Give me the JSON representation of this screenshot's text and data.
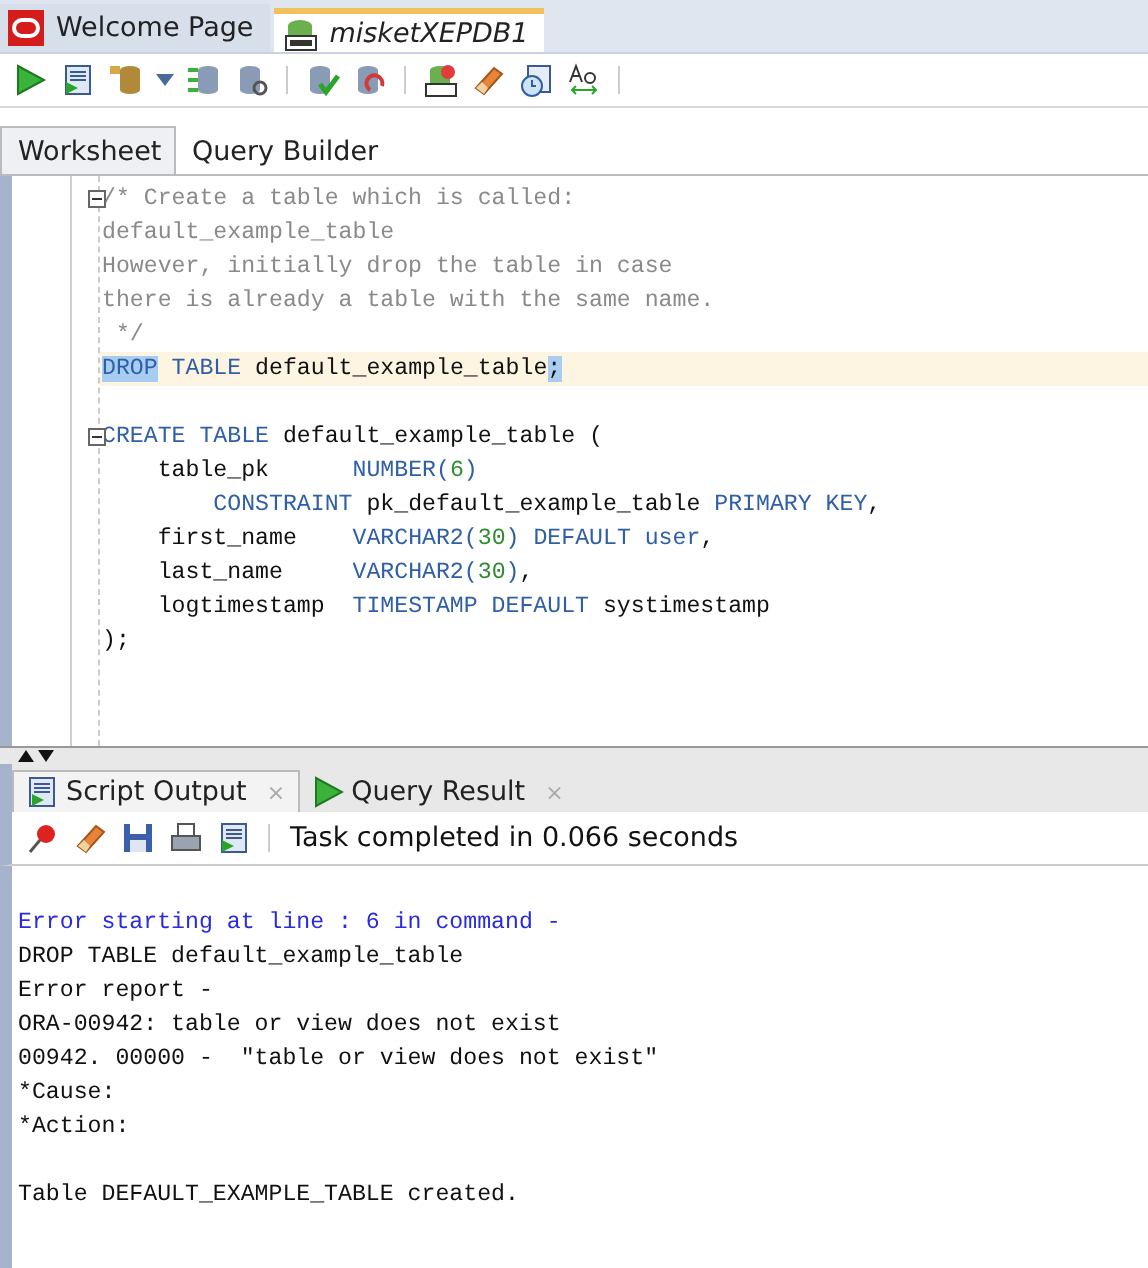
{
  "editor_tabs": [
    {
      "label": "Welcome Page",
      "selected": false
    },
    {
      "label": "misketXEPDB1",
      "selected": true
    }
  ],
  "sub_tabs": [
    {
      "label": "Worksheet",
      "selected": true
    },
    {
      "label": "Query Builder",
      "selected": false
    }
  ],
  "code_lines": [
    {
      "fold": true,
      "current": false,
      "tokens": [
        {
          "text": "/* Create a table which is called:",
          "kind": "comment",
          "highlighted": false
        }
      ]
    },
    {
      "fold": false,
      "current": false,
      "tokens": [
        {
          "text": "default_example_table",
          "kind": "comment",
          "highlighted": false
        }
      ]
    },
    {
      "fold": false,
      "current": false,
      "tokens": [
        {
          "text": "However, initially drop the table in case",
          "kind": "comment",
          "highlighted": false
        }
      ]
    },
    {
      "fold": false,
      "current": false,
      "tokens": [
        {
          "text": "there is already a table with the same name.",
          "kind": "comment",
          "highlighted": false
        }
      ]
    },
    {
      "fold": false,
      "current": false,
      "tokens": [
        {
          "text": " */",
          "kind": "comment",
          "highlighted": false
        }
      ]
    },
    {
      "fold": false,
      "current": true,
      "tokens": [
        {
          "text": "DROP",
          "kind": "keyword",
          "highlighted": true
        },
        {
          "text": " TABLE",
          "kind": "keyword",
          "highlighted": false
        },
        {
          "text": " default_example_table",
          "kind": "plain",
          "highlighted": false
        },
        {
          "text": ";",
          "kind": "plain",
          "highlighted": true
        }
      ]
    },
    {
      "fold": false,
      "current": false,
      "kind": "blank"
    },
    {
      "fold": true,
      "current": false,
      "tokens": [
        {
          "text": "CREATE TABLE",
          "kind": "keyword",
          "highlighted": false
        },
        {
          "text": " default_example_table (",
          "kind": "plain",
          "highlighted": false
        }
      ]
    },
    {
      "fold": false,
      "current": false,
      "tokens": [
        {
          "text": "    table_pk      ",
          "kind": "plain",
          "highlighted": false
        },
        {
          "text": "NUMBER(",
          "kind": "keyword",
          "highlighted": false
        },
        {
          "text": "6",
          "kind": "number",
          "highlighted": false
        },
        {
          "text": ")",
          "kind": "keyword",
          "highlighted": false
        }
      ]
    },
    {
      "fold": false,
      "current": false,
      "tokens": [
        {
          "text": "        CONSTRAINT",
          "kind": "keyword",
          "highlighted": false
        },
        {
          "text": " pk_default_example_table ",
          "kind": "plain",
          "highlighted": false
        },
        {
          "text": "PRIMARY KEY",
          "kind": "keyword",
          "highlighted": false
        },
        {
          "text": ",",
          "kind": "plain",
          "highlighted": false
        }
      ]
    },
    {
      "fold": false,
      "current": false,
      "tokens": [
        {
          "text": "    first_name    ",
          "kind": "plain",
          "highlighted": false
        },
        {
          "text": "VARCHAR2(",
          "kind": "keyword",
          "highlighted": false
        },
        {
          "text": "30",
          "kind": "number",
          "highlighted": false
        },
        {
          "text": ") DEFAULT user",
          "kind": "keyword",
          "highlighted": false
        },
        {
          "text": ",",
          "kind": "plain",
          "highlighted": false
        }
      ]
    },
    {
      "fold": false,
      "current": false,
      "tokens": [
        {
          "text": "    last_name     ",
          "kind": "plain",
          "highlighted": false
        },
        {
          "text": "VARCHAR2(",
          "kind": "keyword",
          "highlighted": false
        },
        {
          "text": "30",
          "kind": "number",
          "highlighted": false
        },
        {
          "text": ")",
          "kind": "keyword",
          "highlighted": false
        },
        {
          "text": ",",
          "kind": "plain",
          "highlighted": false
        }
      ]
    },
    {
      "fold": false,
      "current": false,
      "tokens": [
        {
          "text": "    logtimestamp  ",
          "kind": "plain",
          "highlighted": false
        },
        {
          "text": "TIMESTAMP DEFAULT",
          "kind": "keyword",
          "highlighted": false
        },
        {
          "text": " systimestamp",
          "kind": "plain",
          "highlighted": false
        }
      ]
    },
    {
      "fold": false,
      "current": false,
      "tokens": [
        {
          "text": ");",
          "kind": "plain",
          "highlighted": false
        }
      ]
    }
  ],
  "output_tabs": [
    {
      "label": "Script Output",
      "close": "×",
      "selected": true
    },
    {
      "label": "Query Result",
      "close": "×",
      "selected": false
    }
  ],
  "status": "Task completed in 0.066 seconds",
  "output_lines": [
    {
      "kind": "blank"
    },
    {
      "kind": "error",
      "text": "Error starting at line : 6 in command -"
    },
    {
      "kind": "plain",
      "text": "DROP TABLE default_example_table"
    },
    {
      "kind": "plain",
      "text": "Error report -"
    },
    {
      "kind": "plain",
      "text": "ORA-00942: table or view does not exist"
    },
    {
      "kind": "plain",
      "text": "00942. 00000 -  \"table or view does not exist\""
    },
    {
      "kind": "plain",
      "text": "*Cause:"
    },
    {
      "kind": "plain",
      "text": "*Action:"
    },
    {
      "kind": "blank"
    },
    {
      "kind": "plain",
      "text": "Table DEFAULT_EXAMPLE_TABLE created."
    }
  ]
}
